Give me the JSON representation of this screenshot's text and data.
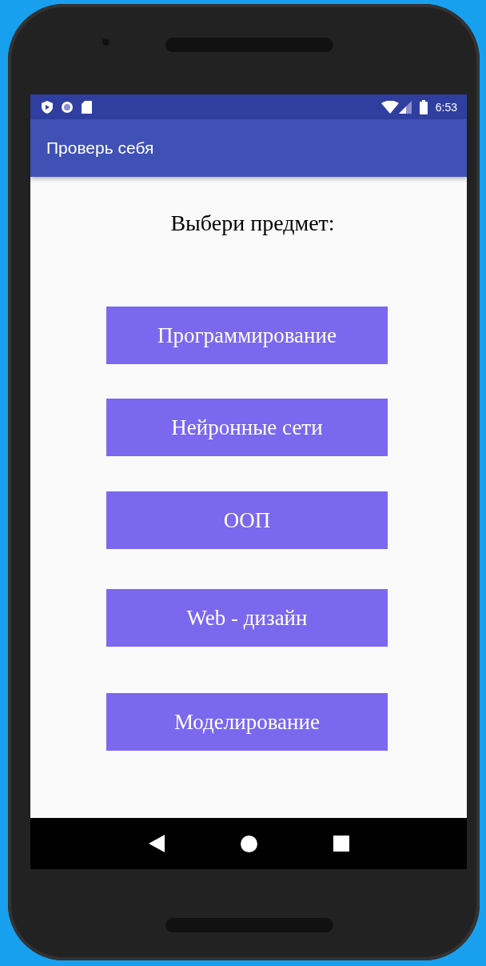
{
  "status_bar": {
    "time": "6:53"
  },
  "app_bar": {
    "title": "Проверь себя"
  },
  "heading": "Выбери предмет:",
  "subjects": [
    {
      "label": "Программирование"
    },
    {
      "label": "Нейронные сети"
    },
    {
      "label": "ООП"
    },
    {
      "label": "Web - дизайн"
    },
    {
      "label": "Моделирование"
    }
  ]
}
